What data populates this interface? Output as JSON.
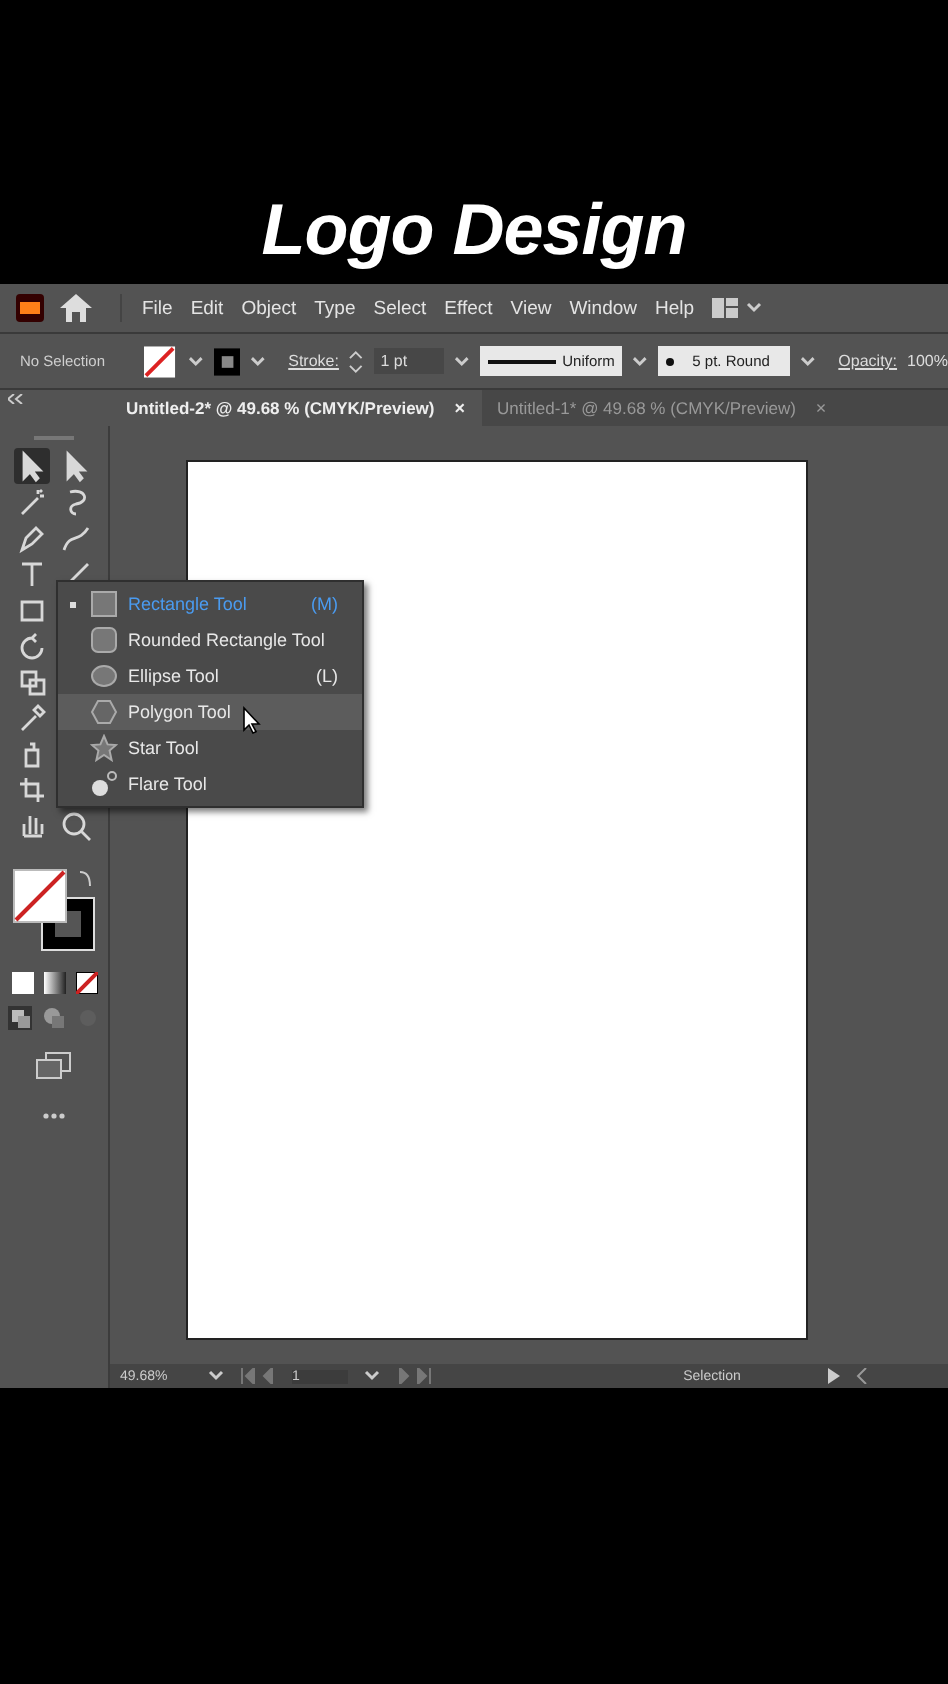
{
  "video_title": "Logo Design",
  "menu": [
    "File",
    "Edit",
    "Object",
    "Type",
    "Select",
    "Effect",
    "View",
    "Window",
    "Help"
  ],
  "control_bar": {
    "selection": "No Selection",
    "stroke_label": "Stroke:",
    "stroke_weight": "1 pt",
    "profile": "Uniform",
    "brush": "5 pt. Round",
    "opacity_label": "Opacity:",
    "opacity": "100%"
  },
  "tabs": [
    {
      "label": "Untitled-2* @ 49.68 % (CMYK/Preview)",
      "close": "×",
      "selected": true
    },
    {
      "label": "Untitled-1* @ 49.68 % (CMYK/Preview)",
      "close": "×",
      "selected": false
    }
  ],
  "flyout": [
    {
      "kind": "rectangle",
      "label": "Rectangle Tool",
      "shortcut": "(M)",
      "selected": true,
      "hovered": false
    },
    {
      "kind": "rounded",
      "label": "Rounded Rectangle Tool",
      "selected": false,
      "hovered": false
    },
    {
      "kind": "ellipse",
      "label": "Ellipse Tool",
      "shortcut": "(L)",
      "selected": false,
      "hovered": false
    },
    {
      "kind": "polygon",
      "label": "Polygon Tool",
      "selected": false,
      "hovered": true
    },
    {
      "kind": "star",
      "label": "Star Tool",
      "selected": false,
      "hovered": false
    },
    {
      "kind": "flare",
      "label": "Flare Tool",
      "selected": false,
      "hovered": false
    }
  ],
  "status_bar": {
    "zoom": "49.68%",
    "artboard": "1",
    "tool": "Selection"
  }
}
